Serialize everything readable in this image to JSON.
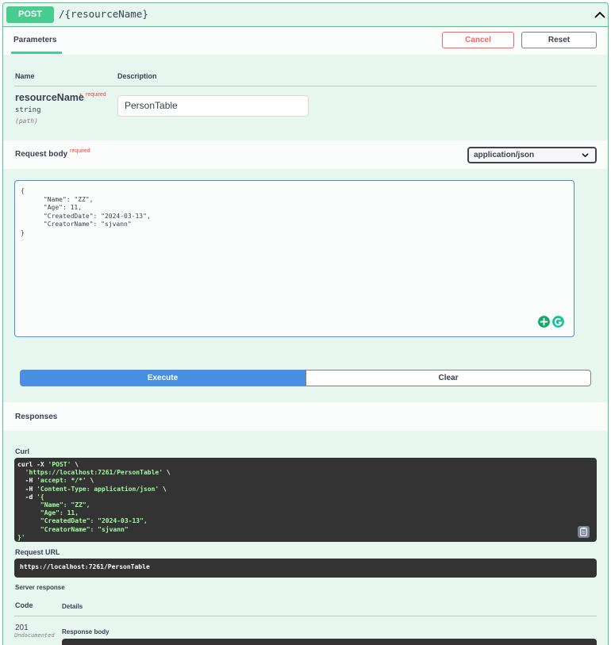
{
  "operation": {
    "method": "POST",
    "path": "/{resourceName}"
  },
  "parameters": {
    "tab_label": "Parameters",
    "cancel_label": "Cancel",
    "reset_label": "Reset",
    "col_name": "Name",
    "col_description": "Description",
    "param": {
      "name": "resourceName",
      "required_star": "*",
      "required_label": "required",
      "type": "string",
      "location": "(path)",
      "value": "PersonTable"
    }
  },
  "request_body": {
    "title": "Request body",
    "required_label": "required",
    "content_type": "application/json",
    "body": "{\n      \"Name\": \"ZZ\",\n      \"Age\": 11,\n      \"CreatedDate\": \"2024-03-13\",\n      \"CreatorName\": \"sjvann\"\n}"
  },
  "actions": {
    "execute_label": "Execute",
    "clear_label": "Clear"
  },
  "responses": {
    "title": "Responses",
    "curl_label": "Curl",
    "curl": {
      "l1_cmd": "curl -X ",
      "l1_str": "'POST'",
      "l1_end": " \\",
      "l2_str": "  'https://localhost:7261/PersonTable'",
      "l2_end": " \\",
      "l3_cmd": "  -H ",
      "l3_str": "'accept: */*'",
      "l3_end": " \\",
      "l4_cmd": "  -H ",
      "l4_str": "'Content-Type: application/json'",
      "l4_end": " \\",
      "l5_cmd": "  -d ",
      "l5_str": "'{\n      \"Name\": \"ZZ\",\n      \"Age\": 11,\n      \"CreatedDate\": \"2024-03-13\",\n      \"CreatorName\": \"sjvann\"\n}'"
    },
    "request_url_label": "Request URL",
    "request_url": "https://localhost:7261/PersonTable",
    "server_response_label": "Server response",
    "col_code": "Code",
    "col_details": "Details",
    "status_code": "201",
    "status_note": "Undocumented",
    "response_body_label": "Response body"
  },
  "icons": {
    "collapse": "chevron-up-icon",
    "select": "chevron-down-icon",
    "copy": "clipboard-icon",
    "grammar": "grammarly-icon",
    "extension": "extension-icon"
  },
  "colors": {
    "post": "#49cc90",
    "block_bg": "#e8f6f0",
    "execute": "#4990e2",
    "cancel": "#ff6060",
    "required": "#f93e3e",
    "code_bg": "#333333",
    "code_string": "#a2fca2"
  }
}
